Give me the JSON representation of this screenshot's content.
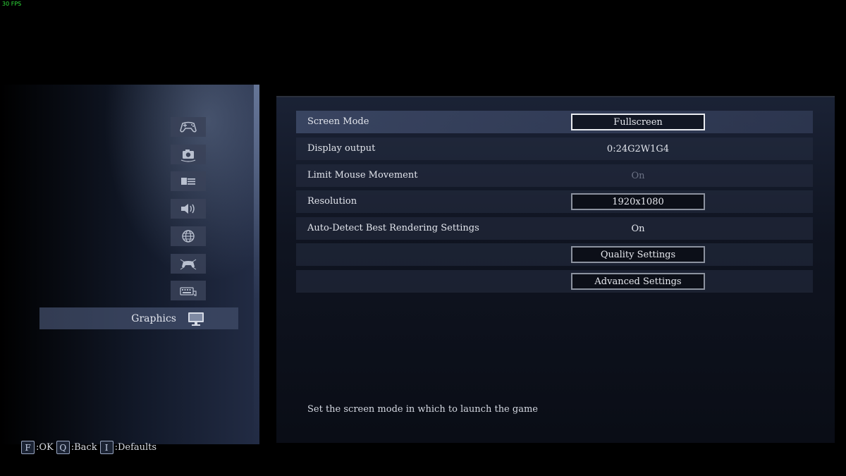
{
  "fps_counter": "30 FPS",
  "categories": [
    {
      "name": "controller",
      "icon": "gamepad-icon"
    },
    {
      "name": "camera",
      "icon": "camera-icon"
    },
    {
      "name": "display",
      "icon": "hud-display-icon"
    },
    {
      "name": "sound",
      "icon": "speaker-icon"
    },
    {
      "name": "network",
      "icon": "globe-icon"
    },
    {
      "name": "key-config-pad",
      "icon": "controller-config-icon"
    },
    {
      "name": "key-config-keyboard",
      "icon": "keyboard-icon"
    }
  ],
  "selected_category": {
    "label": "Graphics",
    "icon": "monitor-icon"
  },
  "settings": {
    "rows": [
      {
        "name": "Screen Mode",
        "value": "Fullscreen",
        "kind": "button"
      },
      {
        "name": "Display output",
        "value": "0:24G2W1G4",
        "kind": "text"
      },
      {
        "name": "Limit Mouse Movement",
        "value": "On",
        "kind": "disabled"
      },
      {
        "name": "Resolution",
        "value": "1920x1080",
        "kind": "button"
      },
      {
        "name": "Auto-Detect Best Rendering Settings",
        "value": "On",
        "kind": "text"
      },
      {
        "name": "",
        "value": "Quality Settings",
        "kind": "button"
      },
      {
        "name": "",
        "value": "Advanced Settings",
        "kind": "button"
      }
    ]
  },
  "description": "Set the screen mode in which to launch the game",
  "footer": {
    "ok": {
      "key": "F",
      "label": ":OK"
    },
    "back": {
      "key": "Q",
      "label": ":Back"
    },
    "defaults": {
      "key": "I",
      "label": ":Defaults"
    }
  },
  "colors": {
    "accent_fps": "#2fe03a",
    "selection": "#3e4a68",
    "button_border": "#8c929f"
  }
}
